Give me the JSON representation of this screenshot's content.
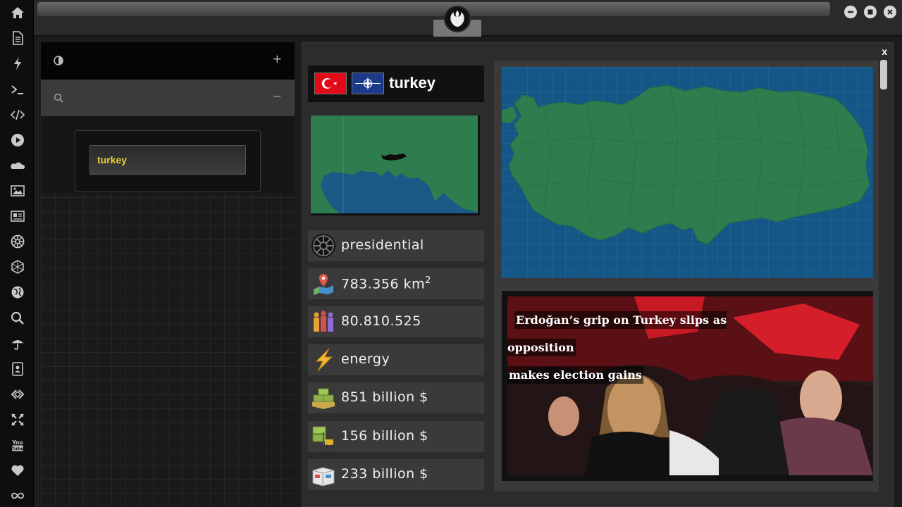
{
  "sidebar": {
    "icons": [
      "home-icon",
      "document-icon",
      "bolt-icon",
      "terminal-icon",
      "code-icon",
      "play-icon",
      "cloud-icon",
      "image-icon",
      "newspaper-icon",
      "empire-icon",
      "hexagon-icon",
      "globe-icon",
      "search-icon",
      "umbrella-icon",
      "contacts-icon",
      "link-icon",
      "expand-icon",
      "youtube-icon",
      "heart-icon",
      "infinity-icon"
    ],
    "youtube_label": "You\nTube"
  },
  "left_panel": {
    "section1_sign": "+",
    "section2_sign": "−",
    "search_value": "turkey"
  },
  "main": {
    "close_label": "x",
    "country": "turkey",
    "stats": [
      {
        "icon": "empire-emblem-icon",
        "text": "presidential"
      },
      {
        "icon": "map-pin-icon",
        "text": "783.356 km",
        "sup": "2"
      },
      {
        "icon": "population-icon",
        "text": "80.810.525"
      },
      {
        "icon": "lightning-icon",
        "text": "energy"
      },
      {
        "icon": "cash-stack-icon",
        "text": "851 billion $"
      },
      {
        "icon": "forklift-goods-icon",
        "text": "156 billion $"
      },
      {
        "icon": "import-boxes-icon",
        "text": "233 billion $"
      }
    ],
    "news_line1": "Erdoğan’s grip on Turkey slips as opposition",
    "news_line2": "makes election gains"
  },
  "colors": {
    "accent_yellow": "#e8d23a",
    "map_sea": "#145787",
    "map_land": "#2e7d4f"
  }
}
